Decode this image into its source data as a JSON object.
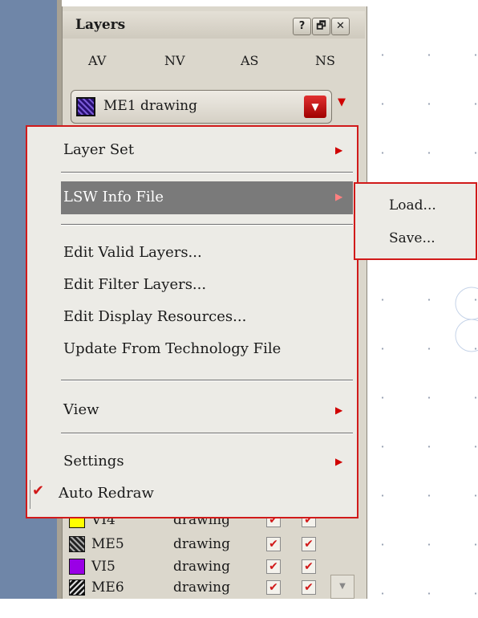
{
  "panel": {
    "title": "Layers",
    "buttons": [
      "?",
      "🗗",
      "✕"
    ],
    "tabs": [
      "AV",
      "NV",
      "AS",
      "NS"
    ]
  },
  "layer_selector": {
    "value": "ME1 drawing"
  },
  "menu": {
    "items": [
      {
        "label": "Layer Set",
        "submenu": true
      },
      {
        "label": "LSW Info File",
        "submenu": true,
        "highlighted": true
      },
      {
        "label": "Edit Valid Layers..."
      },
      {
        "label": "Edit Filter Layers..."
      },
      {
        "label": "Edit Display Resources..."
      },
      {
        "label": "Update From Technology File"
      },
      {
        "label": "View",
        "submenu": true
      },
      {
        "label": "Settings",
        "submenu": true
      },
      {
        "label": "Auto Redraw",
        "checked": true
      }
    ],
    "check_glyph": "✔",
    "submenu_items": [
      "Load...",
      "Save..."
    ]
  },
  "layers": [
    {
      "name": "VI4",
      "purpose": "drawing",
      "color": "#ffff00",
      "visible": true,
      "selectable": true
    },
    {
      "name": "ME5",
      "purpose": "drawing",
      "color": "#404040",
      "visible": true,
      "selectable": true
    },
    {
      "name": "VI5",
      "purpose": "drawing",
      "color": "#9a00e6",
      "visible": true,
      "selectable": true
    },
    {
      "name": "ME6",
      "purpose": "drawing",
      "color": "#202020",
      "visible": true,
      "selectable": true
    }
  ],
  "colors": {
    "accent_red": "#d11a1a",
    "menu_highlight": "#7a7a7a"
  }
}
